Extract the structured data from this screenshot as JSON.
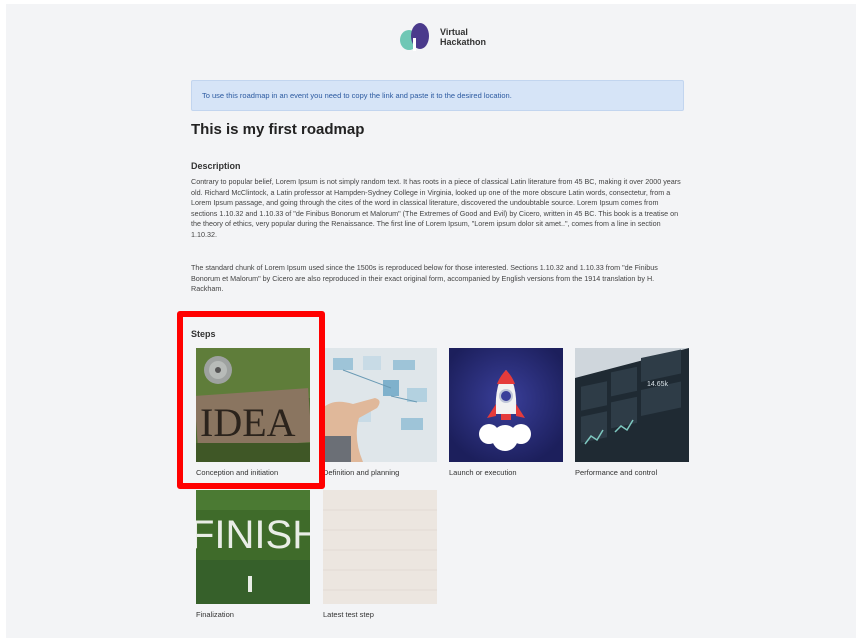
{
  "brand": {
    "line1": "Virtual",
    "line2": "Hackathon"
  },
  "notice": "To use this roadmap in an event you need to copy the link and paste it to the desired location.",
  "title": "This is my first roadmap",
  "description": {
    "heading": "Description",
    "paragraphs": [
      "Contrary to popular belief, Lorem Ipsum is not simply random text. It has roots in a piece of classical Latin literature from 45 BC, making it over 2000 years old. Richard McClintock, a Latin professor at Hampden-Sydney College in Virginia, looked up one of the more obscure Latin words, consectetur, from a Lorem Ipsum passage, and going through the cites of the word in classical literature, discovered the undoubtable source. Lorem Ipsum comes from sections 1.10.32 and 1.10.33 of \"de Finibus Bonorum et Malorum\" (The Extremes of Good and Evil) by Cicero, written in 45 BC. This book is a treatise on the theory of ethics, very popular during the Renaissance. The first line of Lorem Ipsum, \"Lorem ipsum dolor sit amet..\", comes from a line in section 1.10.32.",
      "The standard chunk of Lorem Ipsum used since the 1500s is reproduced below for those interested. Sections 1.10.32 and 1.10.33 from \"de Finibus Bonorum et Malorum\" by Cicero are also reproduced in their exact original form, accompanied by English versions from the 1914 translation by H. Rackham."
    ]
  },
  "steps": {
    "heading": "Steps",
    "items": [
      {
        "label": "Conception and initiation",
        "image_text": "IDEA"
      },
      {
        "label": "Definition and planning"
      },
      {
        "label": "Launch or execution"
      },
      {
        "label": "Performance and control",
        "image_text": "14.65k"
      },
      {
        "label": "Finalization",
        "image_text": "FINISH"
      },
      {
        "label": "Latest test step"
      }
    ]
  },
  "colors": {
    "accent_highlight": "#ff0000",
    "notice_bg": "#d6e4f7",
    "notice_text": "#2c5aa0"
  }
}
